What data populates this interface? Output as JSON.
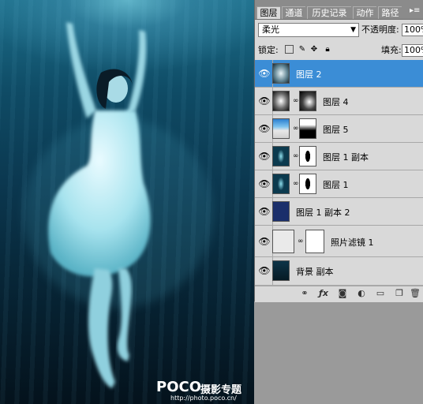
{
  "watermark": {
    "logo": "POCO",
    "title": "摄影专题",
    "url": "http://photo.poco.cn/"
  },
  "panel": {
    "tabs": [
      {
        "label": "图层",
        "active": true
      },
      {
        "label": "通道",
        "active": false
      },
      {
        "label": "历史记录",
        "active": false
      },
      {
        "label": "动作",
        "active": false
      },
      {
        "label": "路径",
        "active": false
      }
    ],
    "blend_mode": "柔光",
    "opacity_label": "不透明度:",
    "opacity_value": "100%",
    "lock_label": "锁定:",
    "fill_label": "填充:",
    "fill_value": "100%"
  },
  "layers": [
    {
      "name": "图层 2",
      "selected": true,
      "thumb": "blurred-figure",
      "mask": false
    },
    {
      "name": "图层 4",
      "selected": false,
      "thumb": "blurred-figure",
      "mask": true
    },
    {
      "name": "图层 5",
      "selected": false,
      "thumb": "water-surface",
      "mask": true
    },
    {
      "name": "图层 1 副本",
      "selected": false,
      "thumb": "figure-cyan",
      "mask": true
    },
    {
      "name": "图层 1",
      "selected": false,
      "thumb": "figure-cyan",
      "mask": true
    },
    {
      "name": "图层 1 副本 2",
      "selected": false,
      "thumb": "solid-navy",
      "mask": false
    },
    {
      "name": "照片滤镜 1",
      "selected": false,
      "thumb": "photo-filter-adjustment",
      "mask": true
    },
    {
      "name": "背景 副本",
      "selected": false,
      "thumb": "original-photo",
      "mask": false
    }
  ],
  "bottom_icons": [
    "link-icon",
    "fx-icon",
    "mask-icon",
    "adjustment-icon",
    "group-icon",
    "new-layer-icon",
    "trash-icon"
  ],
  "colors": {
    "selection": "#3b8dd6",
    "panel": "#d9d9d9",
    "tab_bar": "#8b8b8b",
    "water_deep": "#04121c",
    "water_light": "#1d6f8b"
  }
}
